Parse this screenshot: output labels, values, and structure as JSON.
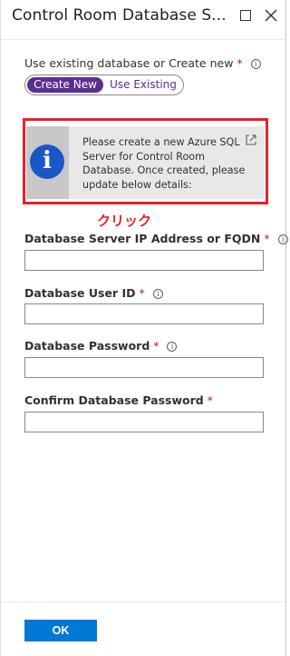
{
  "header": {
    "title": "Control Room Database S...",
    "maximize_icon": "maximize-icon",
    "close_icon": "close-icon"
  },
  "db_choice": {
    "label": "Use existing database or Create new",
    "required_mark": "*",
    "info_glyph": "i",
    "options": [
      "Create New",
      "Use Existing"
    ],
    "selected": "Create New",
    "accent_color": "#5c2e91"
  },
  "info_box": {
    "icon": "info-icon",
    "message": "Please create a new Azure SQL Server for Control Room Database. Once created, please update below details:",
    "external_link_icon": "external-link-icon",
    "highlight_color": "#e8202c"
  },
  "annotation": "クリック",
  "fields": [
    {
      "label": "Database Server IP Address or FQDN",
      "required_mark": "*",
      "info_glyph": "i",
      "value": ""
    },
    {
      "label": "Database User ID",
      "required_mark": "*",
      "info_glyph": "i",
      "value": ""
    },
    {
      "label": "Database Password",
      "required_mark": "*",
      "info_glyph": "i",
      "value": ""
    },
    {
      "label": "Confirm Database Password",
      "required_mark": "*",
      "value": ""
    }
  ],
  "footer": {
    "ok_label": "OK",
    "ok_color": "#0078d4"
  }
}
